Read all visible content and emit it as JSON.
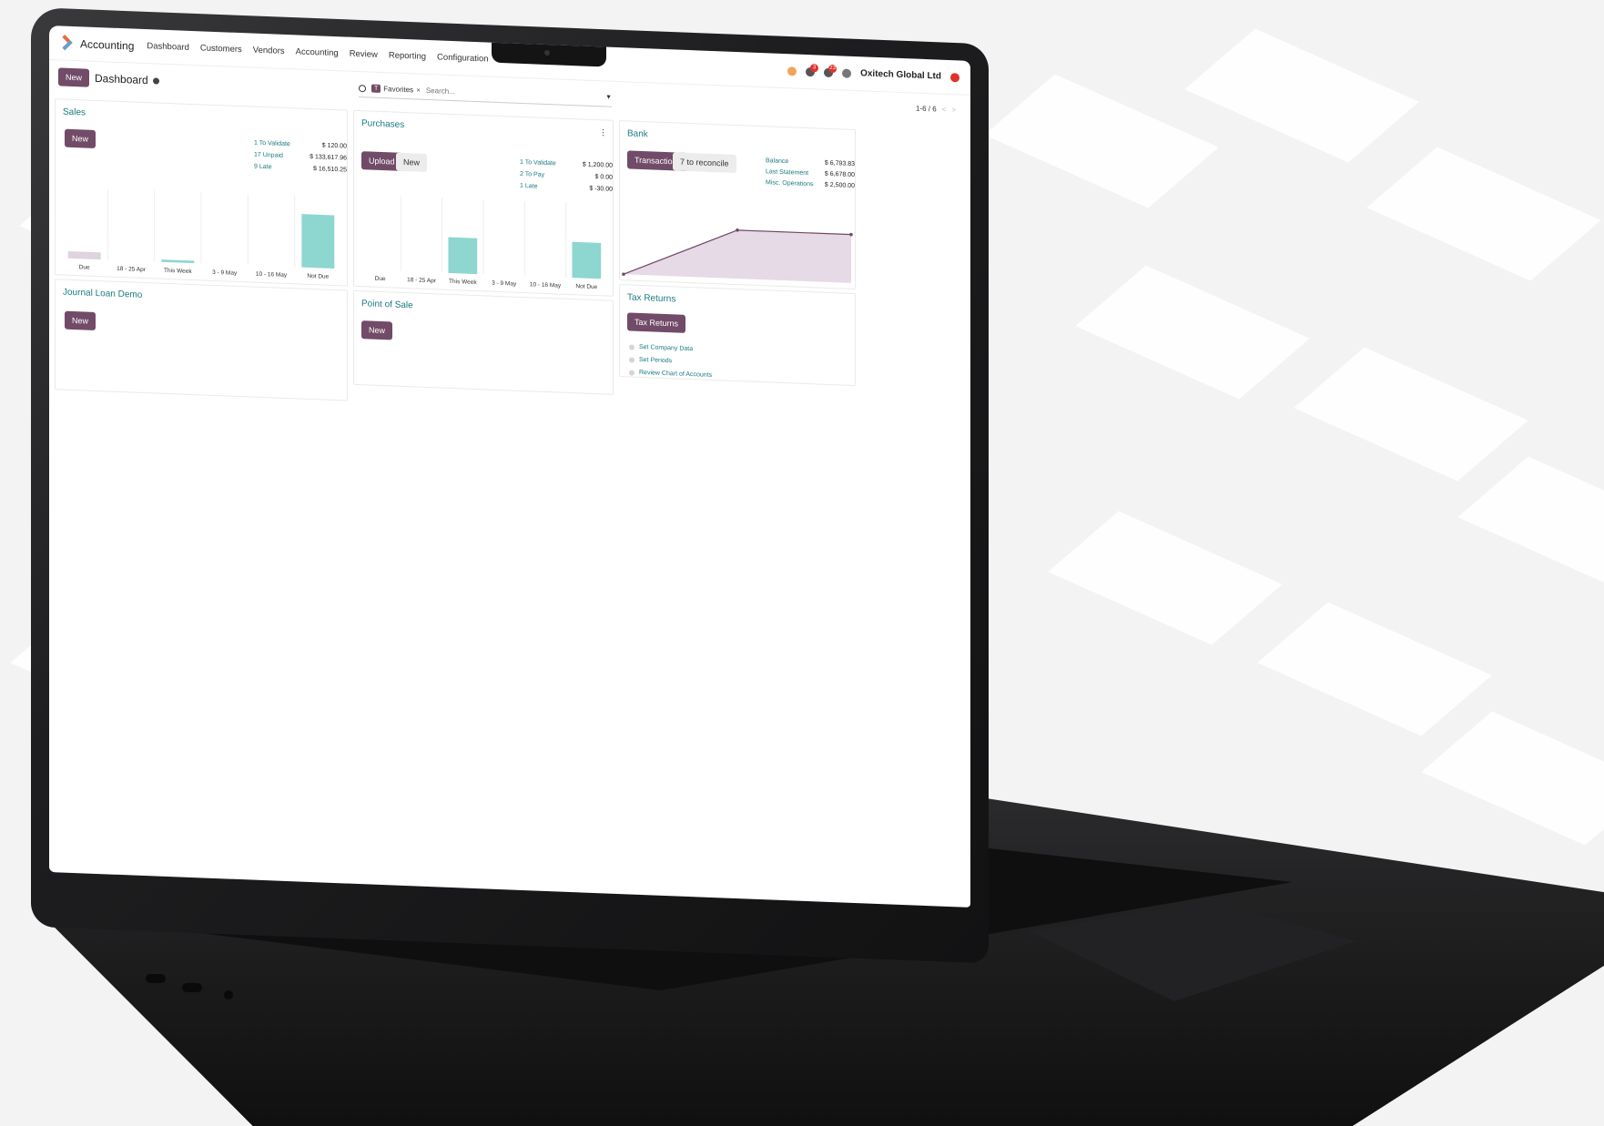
{
  "navbar": {
    "app_name": "Accounting",
    "menu": [
      "Dashboard",
      "Customers",
      "Vendors",
      "Accounting",
      "Review",
      "Reporting",
      "Configuration"
    ],
    "company": "Oxitech Global Ltd",
    "activity_badge": "3",
    "messages_badge": "23"
  },
  "control": {
    "new_label": "New",
    "breadcrumb": "Dashboard",
    "facet_letter": "T",
    "facet_label": "Favorites",
    "facet_close": "×",
    "search_placeholder": "Search...",
    "pager": "1-6 / 6",
    "prev": "<",
    "next": ">"
  },
  "sales": {
    "title": "Sales",
    "new_label": "New",
    "stats": [
      {
        "label": "1 To Validate",
        "value": "$ 120.00"
      },
      {
        "label": "17 Unpaid",
        "value": "$ 133,617.96"
      },
      {
        "label": "9 Late",
        "value": "$ 16,510.25"
      }
    ]
  },
  "purchases": {
    "title": "Purchases",
    "upload_label": "Upload",
    "new_label": "New",
    "stats": [
      {
        "label": "1 To Validate",
        "value": "$ 1,200.00"
      },
      {
        "label": "2 To Pay",
        "value": "$ 0.00"
      },
      {
        "label": "1 Late",
        "value": "$ -30.00"
      }
    ]
  },
  "bank": {
    "title": "Bank",
    "transactions_label": "Transactions",
    "reconcile_label": "7 to reconcile",
    "stats": [
      {
        "label": "Balance",
        "value": "$ 6,793.83"
      },
      {
        "label": "Last Statement",
        "value": "$ 6,678.00"
      },
      {
        "label": "Misc. Operations",
        "value": "$ 2,500.00"
      }
    ]
  },
  "journal": {
    "title": "Journal Loan Demo",
    "new_label": "New"
  },
  "pos": {
    "title": "Point of Sale",
    "new_label": "New"
  },
  "tax": {
    "title": "Tax Returns",
    "button_label": "Tax Returns",
    "tasks": [
      "Set Company Data",
      "Set Periods",
      "Review Chart of Accounts"
    ]
  },
  "chart_data": [
    {
      "type": "bar",
      "categories": [
        "Due",
        "18 - 25 Apr",
        "This Week",
        "3 - 9 May",
        "10 - 16 May",
        "Not Due"
      ],
      "values": [
        12,
        0,
        4,
        0,
        0,
        90
      ],
      "colors": [
        "#ded3de",
        "#8ed6d0",
        "#8ed6d0",
        "#8ed6d0",
        "#8ed6d0",
        "#8ed6d0"
      ],
      "ylim": [
        0,
        120
      ]
    },
    {
      "type": "bar",
      "categories": [
        "Due",
        "18 - 25 Apr",
        "This Week",
        "3 - 9 May",
        "10 - 16 May",
        "Not Due"
      ],
      "values": [
        0,
        0,
        48,
        0,
        0,
        48
      ],
      "colors": [
        "#8ed6d0",
        "#8ed6d0",
        "#8ed6d0",
        "#8ed6d0",
        "#8ed6d0",
        "#8ed6d0"
      ],
      "ylim": [
        0,
        100
      ]
    },
    {
      "type": "area",
      "x": [
        0,
        1,
        2
      ],
      "values": [
        0,
        70,
        70
      ],
      "colors": [
        "#e5dae5",
        "#714b67"
      ],
      "ylim": [
        0,
        100
      ]
    }
  ]
}
